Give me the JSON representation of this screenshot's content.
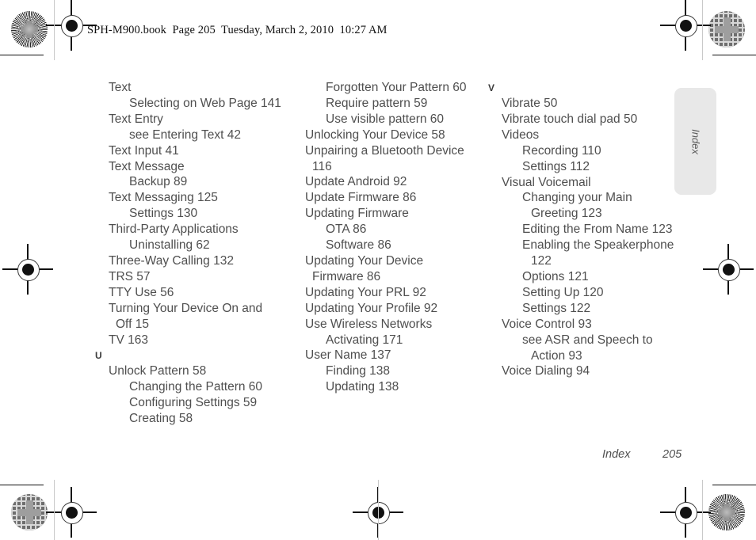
{
  "header": {
    "text": "SPH-M900.book  Page 205  Tuesday, March 2, 2010  10:27 AM"
  },
  "side_tab": {
    "label": "Index"
  },
  "footer": {
    "label": "Index",
    "page_number": "205"
  },
  "colors": {
    "text": "#4f4f4f",
    "header_text": "#111111",
    "tab_background": "#e8e8e8",
    "page_background": "#ffffff"
  },
  "columns": [
    {
      "name": "column-1",
      "lines": [
        {
          "type": "entry",
          "text": "Text"
        },
        {
          "type": "subentry",
          "text": "Selecting on Web Page 141"
        },
        {
          "type": "entry",
          "text": "Text Entry"
        },
        {
          "type": "subentry",
          "text": "see Entering Text 42"
        },
        {
          "type": "entry",
          "text": "Text Input 41"
        },
        {
          "type": "entry",
          "text": "Text Message"
        },
        {
          "type": "subentry",
          "text": "Backup 89"
        },
        {
          "type": "entry",
          "text": "Text Messaging 125"
        },
        {
          "type": "subentry",
          "text": "Settings 130"
        },
        {
          "type": "entry",
          "text": "Third-Party Applications"
        },
        {
          "type": "subentry",
          "text": "Uninstalling 62"
        },
        {
          "type": "entry",
          "text": "Three-Way Calling 132"
        },
        {
          "type": "entry",
          "text": "TRS 57"
        },
        {
          "type": "entry",
          "text": "TTY Use 56"
        },
        {
          "type": "entry",
          "text": "Turning Your Device On and"
        },
        {
          "type": "entry-wrap",
          "text": "Off 15"
        },
        {
          "type": "entry",
          "text": "TV 163"
        },
        {
          "type": "section",
          "text": "U"
        },
        {
          "type": "entry",
          "text": "Unlock Pattern 58"
        },
        {
          "type": "subentry",
          "text": "Changing the Pattern 60"
        },
        {
          "type": "subentry",
          "text": "Configuring Settings 59"
        },
        {
          "type": "subentry",
          "text": "Creating 58"
        }
      ]
    },
    {
      "name": "column-2",
      "lines": [
        {
          "type": "subentry",
          "text": "Forgotten Your Pattern 60"
        },
        {
          "type": "subentry",
          "text": "Require pattern 59"
        },
        {
          "type": "subentry",
          "text": "Use visible pattern 60"
        },
        {
          "type": "entry",
          "text": "Unlocking Your Device 58"
        },
        {
          "type": "entry",
          "text": "Unpairing a Bluetooth Device"
        },
        {
          "type": "entry-wrap",
          "text": "116"
        },
        {
          "type": "entry",
          "text": "Update Android 92"
        },
        {
          "type": "entry",
          "text": "Update Firmware 86"
        },
        {
          "type": "entry",
          "text": "Updating Firmware"
        },
        {
          "type": "subentry",
          "text": "OTA 86"
        },
        {
          "type": "subentry",
          "text": "Software 86"
        },
        {
          "type": "entry",
          "text": "Updating Your Device"
        },
        {
          "type": "entry-wrap",
          "text": "Firmware 86"
        },
        {
          "type": "entry",
          "text": "Updating Your PRL 92"
        },
        {
          "type": "entry",
          "text": "Updating Your Profile 92"
        },
        {
          "type": "entry",
          "text": "Use Wireless Networks"
        },
        {
          "type": "subentry",
          "text": "Activating 171"
        },
        {
          "type": "entry",
          "text": "User Name 137"
        },
        {
          "type": "subentry",
          "text": "Finding 138"
        },
        {
          "type": "subentry",
          "text": "Updating 138"
        }
      ]
    },
    {
      "name": "column-3",
      "lines": [
        {
          "type": "section",
          "text": "V"
        },
        {
          "type": "entry",
          "text": "Vibrate 50"
        },
        {
          "type": "entry",
          "text": "Vibrate touch dial pad 50"
        },
        {
          "type": "entry",
          "text": "Videos"
        },
        {
          "type": "subentry",
          "text": "Recording 110"
        },
        {
          "type": "subentry",
          "text": "Settings 112"
        },
        {
          "type": "entry",
          "text": "Visual Voicemail"
        },
        {
          "type": "subentry",
          "text": "Changing your Main"
        },
        {
          "type": "subentry-wrap",
          "text": "Greeting 123"
        },
        {
          "type": "subentry",
          "text": "Editing the From Name 123"
        },
        {
          "type": "subentry",
          "text": "Enabling the Speakerphone"
        },
        {
          "type": "subentry-wrap",
          "text": "122"
        },
        {
          "type": "subentry",
          "text": "Options 121"
        },
        {
          "type": "subentry",
          "text": "Setting Up 120"
        },
        {
          "type": "subentry",
          "text": "Settings 122"
        },
        {
          "type": "entry",
          "text": "Voice Control 93"
        },
        {
          "type": "subentry",
          "text": "see ASR and Speech to"
        },
        {
          "type": "subentry-wrap",
          "text": "Action 93"
        },
        {
          "type": "entry",
          "text": "Voice Dialing 94"
        }
      ]
    }
  ],
  "print_marks": {
    "star_targets": [
      "top-left-star-target",
      "bottom-right-star-target"
    ],
    "maze_targets": [
      "top-right-maze-target",
      "bottom-left-maze-target"
    ],
    "crosshairs": [
      "top-left-crosshair",
      "top-right-crosshair",
      "bottom-left-crosshair",
      "bottom-right-crosshair",
      "mid-left-crosshair",
      "mid-right-crosshair",
      "bottom-center-crosshair"
    ]
  }
}
